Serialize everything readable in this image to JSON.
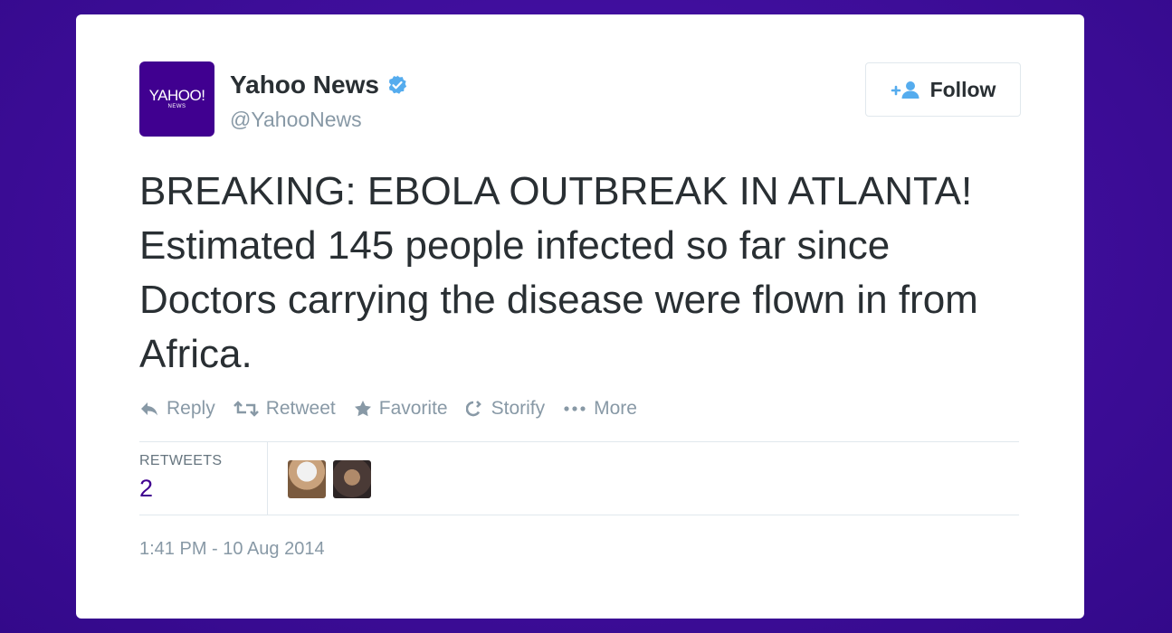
{
  "account": {
    "logo_text": "YAHOO!",
    "logo_subtext": "NEWS",
    "name": "Yahoo News",
    "handle": "@YahooNews",
    "verified_icon": "verified-badge-icon"
  },
  "follow_button": {
    "label": "Follow",
    "icon": "add-user-icon"
  },
  "tweet": {
    "text": "BREAKING: EBOLA OUTBREAK IN ATLANTA! Estimated 145 people infected so far since Doctors carrying the disease were flown in from Africa."
  },
  "actions": [
    {
      "label": "Reply",
      "icon": "reply-icon"
    },
    {
      "label": "Retweet",
      "icon": "retweet-icon"
    },
    {
      "label": "Favorite",
      "icon": "star-icon"
    },
    {
      "label": "Storify",
      "icon": "storify-icon"
    },
    {
      "label": "More",
      "icon": "more-dots-icon"
    }
  ],
  "stats": {
    "retweets_label": "RETWEETS",
    "retweets_count": "2"
  },
  "timestamp": "1:41 PM - 10 Aug 2014",
  "colors": {
    "background": "#3d0d98",
    "brand_purple": "#400090",
    "verified_blue": "#55acee",
    "muted_text": "#8899a6"
  }
}
